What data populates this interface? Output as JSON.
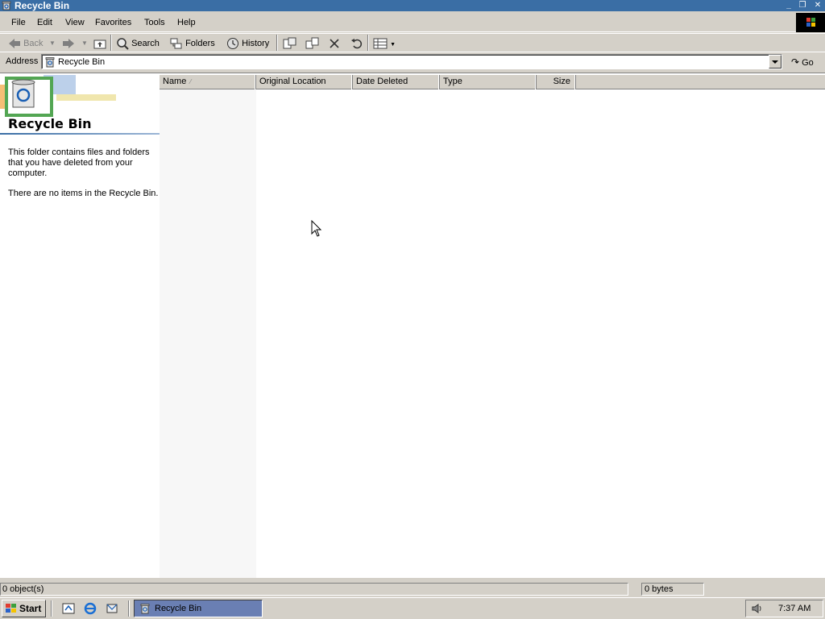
{
  "window": {
    "title": "Recycle Bin"
  },
  "menu": [
    "File",
    "Edit",
    "View",
    "Favorites",
    "Tools",
    "Help"
  ],
  "toolbar": {
    "back": "Back",
    "search": "Search",
    "folders": "Folders",
    "history": "History"
  },
  "address": {
    "label": "Address",
    "value": "Recycle Bin",
    "go": "Go"
  },
  "left_pane": {
    "heading": "Recycle Bin",
    "description": "This folder contains files and folders that you have deleted from your computer.",
    "empty_note": "There are no items in the Recycle Bin."
  },
  "columns": [
    "Name",
    "Original Location",
    "Date Deleted",
    "Type",
    "Size"
  ],
  "status": {
    "objects": "0 object(s)",
    "size": "0 bytes"
  },
  "taskbar": {
    "start": "Start",
    "task": "Recycle Bin",
    "clock": "7:37 AM"
  },
  "colors": {
    "titlebar": "#3a6ea5",
    "face": "#d4d0c8",
    "task_active": "#6a7fb3"
  }
}
